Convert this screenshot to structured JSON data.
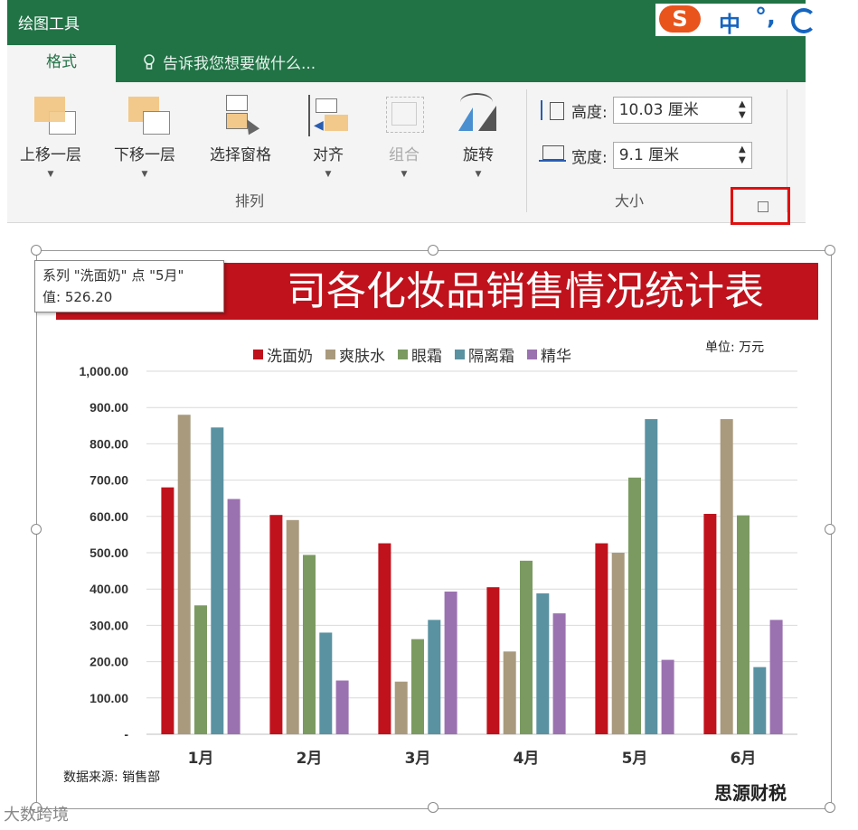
{
  "ribbon": {
    "context_label": "绘图工具",
    "active_tab": "格式",
    "tell_me": "告诉我您想要做什么...",
    "arrange_group": "排列",
    "size_group": "大小",
    "buttons": [
      {
        "label": "上移一层"
      },
      {
        "label": "下移一层"
      },
      {
        "label": "选择窗格"
      },
      {
        "label": "对齐"
      },
      {
        "label": "组合"
      },
      {
        "label": "旋转"
      }
    ],
    "height_label": "高度:",
    "height_value": "10.03 厘米",
    "width_label": "宽度:",
    "width_value": "9.1 厘米"
  },
  "ime": {
    "logo": "S",
    "mode": "中",
    "punct": "°,"
  },
  "tooltip": {
    "line1": "系列 \"洗面奶\" 点 \"5月\"",
    "line2": "值:  526.20"
  },
  "chart_data": {
    "type": "bar",
    "title": "司各化妆品销售情况统计表",
    "unit_note": "单位: 万元",
    "source_note": "数据来源: 销售部",
    "categories": [
      "1月",
      "2月",
      "3月",
      "4月",
      "5月",
      "6月"
    ],
    "y_ticks": [
      "-",
      "100.00",
      "200.00",
      "300.00",
      "400.00",
      "500.00",
      "600.00",
      "700.00",
      "800.00",
      "900.00",
      "1,000.00"
    ],
    "ylim": [
      0,
      1000
    ],
    "grid": true,
    "legend_position": "top",
    "series": [
      {
        "name": "洗面奶",
        "color": "#c0121c",
        "values": [
          680,
          604,
          526,
          405,
          526,
          607
        ]
      },
      {
        "name": "爽肤水",
        "color": "#a99a7e",
        "values": [
          880,
          590,
          145,
          228,
          500,
          868
        ]
      },
      {
        "name": "眼霜",
        "color": "#7b9a62",
        "values": [
          355,
          494,
          262,
          478,
          707,
          603
        ]
      },
      {
        "name": "隔离霜",
        "color": "#5a92a2",
        "values": [
          845,
          280,
          315,
          388,
          868,
          185
        ]
      },
      {
        "name": "精华",
        "color": "#9b72b0",
        "values": [
          648,
          148,
          393,
          333,
          205,
          315
        ]
      }
    ]
  },
  "watermarks": {
    "left": "大数跨境",
    "right": "思源财税"
  }
}
